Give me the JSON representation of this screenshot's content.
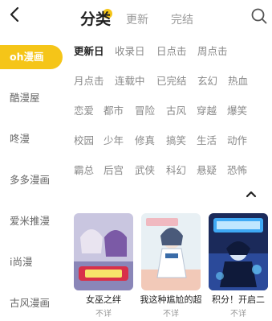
{
  "header": {
    "tabs": [
      {
        "label": "分类",
        "active": true
      },
      {
        "label": "更新",
        "active": false
      },
      {
        "label": "完结",
        "active": false
      }
    ],
    "accent_color": "#f5c518",
    "back_icon": "chevron-left-icon",
    "search_icon": "search-icon"
  },
  "sidebar": {
    "items": [
      {
        "label": "oh漫画",
        "active": true
      },
      {
        "label": "酷漫屋",
        "active": false
      },
      {
        "label": "咚漫",
        "active": false
      },
      {
        "label": "多多漫画",
        "active": false
      },
      {
        "label": "爱米推漫",
        "active": false
      },
      {
        "label": "i尚漫",
        "active": false
      },
      {
        "label": "古风漫画",
        "active": false
      }
    ]
  },
  "filters": {
    "rows": [
      [
        "更新日",
        "收录日",
        "日点击",
        "周点击"
      ],
      [
        "月点击",
        "连载中",
        "已完结",
        "玄幻",
        "热血"
      ],
      [
        "恋爱",
        "都市",
        "冒险",
        "古风",
        "穿越",
        "爆笑"
      ],
      [
        "校园",
        "少年",
        "修真",
        "搞笑",
        "生活",
        "动作"
      ],
      [
        "霸总",
        "后宫",
        "武侠",
        "科幻",
        "悬疑",
        "恐怖"
      ]
    ],
    "selected": "更新日"
  },
  "comics": [
    {
      "title": "女巫之绊",
      "subtitle": "不详"
    },
    {
      "title": "我这种尴尬的超",
      "subtitle": "不详"
    },
    {
      "title": "积分！开启二",
      "subtitle": "不详"
    }
  ]
}
